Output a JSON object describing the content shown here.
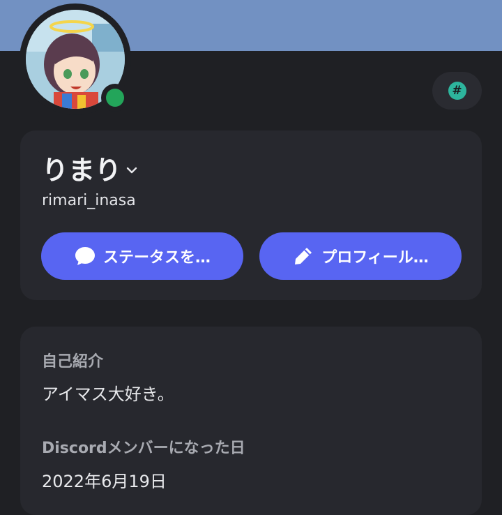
{
  "profile": {
    "display_name": "りまり",
    "username": "rimari_inasa",
    "status": "online",
    "badge_icon": "hashtag-badge-icon",
    "status_color": "#23a55a",
    "accent": "#5865f2",
    "banner_color": "#7291c2"
  },
  "actions": {
    "status_label": "ステータスを…",
    "status_icon": "speech-bubble-icon",
    "edit_profile_label": "プロフィール…",
    "edit_profile_icon": "pencil-icon"
  },
  "about": {
    "bio_title": "自己紹介",
    "bio_text": "アイマス大好き。",
    "member_since_title": "Discordメンバーになった日",
    "member_since_value": "2022年6月19日"
  }
}
